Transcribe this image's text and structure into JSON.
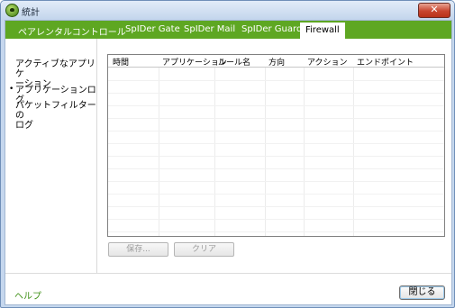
{
  "window": {
    "title": "統計",
    "close_symbol": "✕"
  },
  "tabs": [
    {
      "label": "ペアレンタルコントロール",
      "active": false
    },
    {
      "label": "SpIDer Gate",
      "active": false
    },
    {
      "label": "SpIDer Mail",
      "active": false
    },
    {
      "label": "SpIDer Guard",
      "active": false
    },
    {
      "label": "Firewall",
      "active": true
    }
  ],
  "sidebar": {
    "items": [
      {
        "label_line1": "アクティブなアプリケ",
        "label_line2": "ーション",
        "selected": false
      },
      {
        "label_line1": "アプリケーションログ",
        "label_line2": "",
        "selected": true
      },
      {
        "label_line1": "パケットフィルターの",
        "label_line2": "ログ",
        "selected": false
      }
    ],
    "bullet": "•"
  },
  "table": {
    "columns": [
      "時間",
      "アプリケーション",
      "ルール名",
      "方向",
      "アクション",
      "エンドポイント"
    ],
    "rows": []
  },
  "buttons": {
    "save": "保存...",
    "clear": "クリア",
    "close": "閉じる"
  },
  "footer": {
    "help": "ヘルプ"
  },
  "colors": {
    "accent": "#5ea722",
    "help_link": "#3d8f14"
  }
}
